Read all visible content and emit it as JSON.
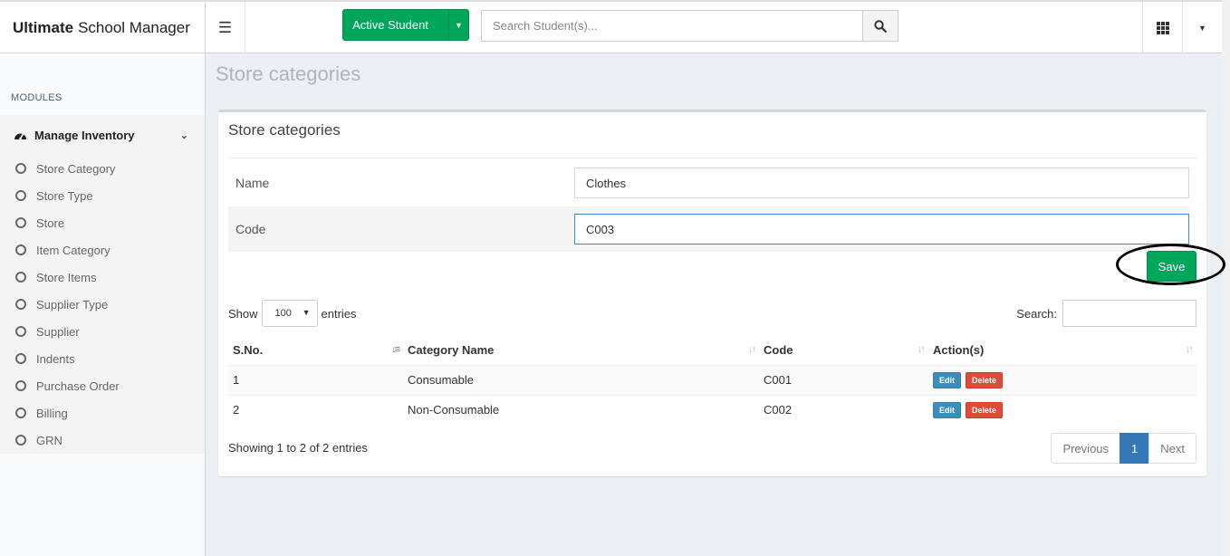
{
  "brand": {
    "bold": "Ultimate",
    "rest": "School Manager"
  },
  "header": {
    "menu_icon": "hamburger-icon",
    "active_student_label": "Active Student",
    "search_placeholder": "Search Student(s)...",
    "search_icon": "search-icon",
    "apps_icon": "grid-icon",
    "user_dropdown_icon": "caret-down-icon"
  },
  "sidebar": {
    "modules_header": "MODULES",
    "group": {
      "label": "Manage Inventory",
      "icon": "dashboard-icon",
      "chevron_icon": "chevron-down-icon"
    },
    "items": [
      {
        "label": "Store Category"
      },
      {
        "label": "Store Type"
      },
      {
        "label": "Store"
      },
      {
        "label": "Item Category"
      },
      {
        "label": "Store Items"
      },
      {
        "label": "Supplier Type"
      },
      {
        "label": "Supplier"
      },
      {
        "label": "Indents"
      },
      {
        "label": "Purchase Order"
      },
      {
        "label": "Billing"
      },
      {
        "label": "GRN"
      }
    ]
  },
  "page": {
    "title": "Store categories"
  },
  "form": {
    "box_title": "Store categories",
    "name_label": "Name",
    "name_value": "Clothes",
    "code_label": "Code",
    "code_value": "C003",
    "save_label": "Save"
  },
  "table": {
    "show_label": "Show",
    "entries_value": "100",
    "entries_label": "entries",
    "search_label": "Search:",
    "columns": [
      "S.No.",
      "Category Name",
      "Code",
      "Action(s)"
    ],
    "rows": [
      {
        "sno": "1",
        "name": "Consumable",
        "code": "C001"
      },
      {
        "sno": "2",
        "name": "Non-Consumable",
        "code": "C002"
      }
    ],
    "edit_label": "Edit",
    "delete_label": "Delete",
    "info": "Showing 1 to 2 of 2 entries",
    "pagination": {
      "previous": "Previous",
      "current": "1",
      "next": "Next"
    }
  },
  "colors": {
    "accent_green": "#00a65a",
    "accent_blue": "#3c8dbc",
    "danger_red": "#dd4b39",
    "pager_active": "#337ab7"
  }
}
